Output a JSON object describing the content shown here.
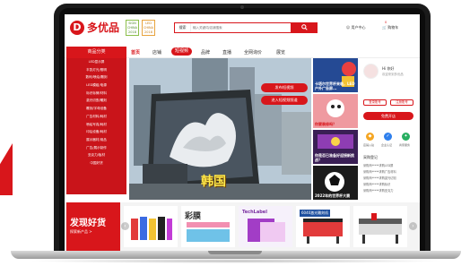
{
  "colors": {
    "brand_red": "#d8161b",
    "dark_red": "#c9141a",
    "accent_green": "#8bbf4a"
  },
  "header": {
    "logo_mark": "D",
    "logo_text": "多优品",
    "badge_1": "SIGN CHINA 2018",
    "badge_2": "LED CHINA 2018",
    "search_type": "搜索",
    "search_placeholder": "输入关键词/店铺搜索",
    "search_button_icon": "search-icon",
    "user_center": "用户中心",
    "cart_label": "购物车",
    "cart_count": "0"
  },
  "nav": {
    "category_header": "商品分类",
    "items": [
      {
        "label": "首页",
        "active": true
      },
      {
        "label": "店铺",
        "active": false
      },
      {
        "label": "短视频",
        "pill": true
      },
      {
        "label": "品牌",
        "active": false
      },
      {
        "label": "直播",
        "active": false
      },
      {
        "label": "全网询价",
        "active": false
      },
      {
        "label": "展览",
        "active": false
      }
    ]
  },
  "sidebar": {
    "items": [
      "LED显示屏",
      "丰凯灯光/照明",
      "数码/喷绘/雕刻",
      "LED模组/电源",
      "标识标牌/材料",
      "激光切割/雕刻",
      "雕刻/字母设备",
      "广告材料/耗材",
      "喷绘写真/耗材",
      "印后设备/耗材",
      "展示器材/用品",
      "广告/展示制作",
      "亚克力/板材",
      "中国好货",
      "",
      "",
      ""
    ]
  },
  "banner": {
    "btn_publish": "发布短视频",
    "btn_enter": "进入短视频频道",
    "overlay_text": "韩国"
  },
  "thumbs": [
    {
      "caption": "卡塔尔世界杯来临，LED户外广告屏..."
    },
    {
      "caption": "你要装修吗？"
    },
    {
      "caption": "你是否已准备好迎接新挑战？"
    },
    {
      "caption": "2022年的世界杯大赛"
    }
  ],
  "right_panel": {
    "greeting": "Hi 你好",
    "welcome": "欢迎来到多优品",
    "btn_login": "登录账号",
    "btn_register": "注册账号",
    "btn_free_store": "免费开店",
    "quick_links": [
      {
        "label": "店铺入驻",
        "color": "#f5a623",
        "icon": "store-icon"
      },
      {
        "label": "企业认证",
        "color": "#2f80ed",
        "icon": "badge-icon"
      },
      {
        "label": "商家服务",
        "color": "#27ae60",
        "icon": "service-icon"
      }
    ],
    "section_title": "采购登记",
    "records": [
      "采购商*****求购LED屏",
      "采购商*****求购广告材料",
      "采购商*****求购激光切割",
      "采购商*****求购标识",
      "采购商*****求购亚克力"
    ]
  },
  "product_strip": {
    "promo_title": "发现好货",
    "promo_subtitle": "探索新产品 >",
    "products": [
      {
        "name": "printer-ink"
      },
      {
        "name": "color-film-roll"
      },
      {
        "name": "heat-transfer-paper"
      },
      {
        "name": "uv-printer"
      },
      {
        "name": "laser-engraver"
      },
      {
        "name": "cnc-cutter"
      }
    ],
    "promo_label_3": "彩膜",
    "promo_label_4": "TechLabel",
    "promo_label_5": "6040激光雕刻机"
  }
}
